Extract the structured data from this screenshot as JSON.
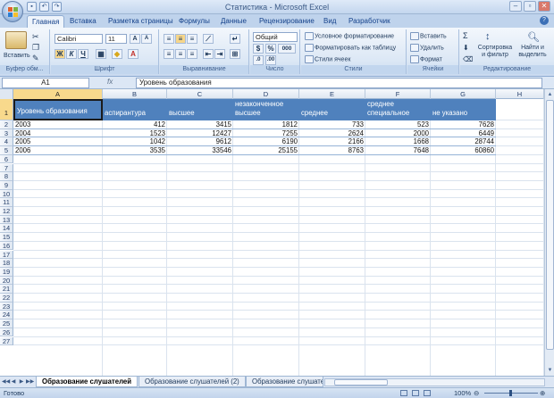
{
  "window": {
    "title": "Статистика - Microsoft Excel"
  },
  "tabs": [
    "Главная",
    "Вставка",
    "Разметка страницы",
    "Формулы",
    "Данные",
    "Рецензирование",
    "Вид",
    "Разработчик"
  ],
  "ribbon": {
    "paste_label": "Вставить",
    "clipboard_label": "Буфер обм...",
    "font_name": "Calibri",
    "font_size": "11",
    "font_label": "Шрифт",
    "align_label": "Выравнивание",
    "number_format": "Общий",
    "number_label": "Число",
    "cond_format": "Условное форматирование",
    "format_table": "Форматировать как таблицу",
    "cell_styles": "Стили ячеек",
    "styles_label": "Стили",
    "insert": "Вставить",
    "delete": "Удалить",
    "format": "Формат",
    "cells_label": "Ячейки",
    "sort_filter": "Сортировка и фильтр",
    "find_select": "Найти и выделить",
    "editing_label": "Редактирование",
    "bold": "Ж",
    "italic": "К",
    "underline": "Ч",
    "percent": "%",
    "thousands": "000",
    "currency": "$",
    "sigma": "Σ"
  },
  "formula_bar": {
    "name_box": "A1",
    "fx": "fx",
    "content": "Уровень образования"
  },
  "columns": [
    "A",
    "B",
    "C",
    "D",
    "E",
    "F",
    "G",
    "H"
  ],
  "rows": [
    "1",
    "2",
    "3",
    "4",
    "5",
    "6",
    "7",
    "8",
    "9",
    "10",
    "11",
    "12",
    "13",
    "14",
    "15",
    "16",
    "17",
    "18",
    "19",
    "20",
    "21",
    "22",
    "23",
    "24",
    "25",
    "26",
    "27"
  ],
  "table": {
    "headers": [
      "Уровень образования",
      "аспирантура",
      "высшее",
      "незаконченное высшее",
      "среднее",
      "среднее специальное",
      "не указано"
    ],
    "rows": [
      [
        "2003",
        "412",
        "3415",
        "1812",
        "733",
        "523",
        "7628"
      ],
      [
        "2004",
        "1523",
        "12427",
        "7255",
        "2624",
        "2000",
        "6449"
      ],
      [
        "2005",
        "1042",
        "9612",
        "6190",
        "2166",
        "1668",
        "28744"
      ],
      [
        "2006",
        "3535",
        "33546",
        "25155",
        "8763",
        "7648",
        "60860"
      ]
    ],
    "header_color": "#4f81bd"
  },
  "sheet_tabs": [
    "Образование слушателей",
    "Образование слушателей (2)",
    "Образование слушате"
  ],
  "status": {
    "ready": "Готово",
    "zoom": "100%"
  }
}
